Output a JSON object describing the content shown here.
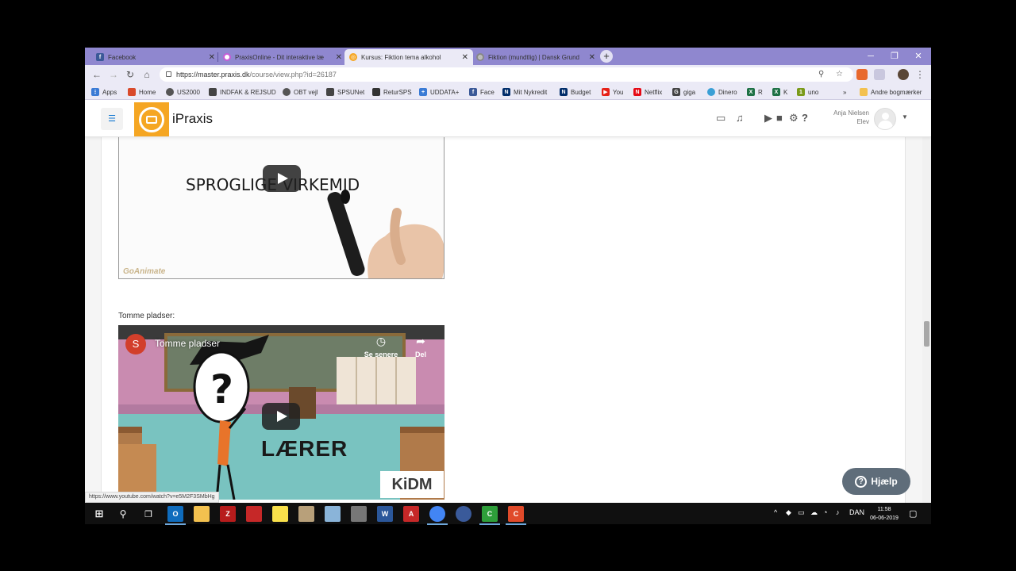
{
  "browser": {
    "tabs": [
      {
        "label": "Facebook",
        "favicon": "facebook-icon",
        "color": "#3b5998"
      },
      {
        "label": "PraxisOnline - Dit interaktive læ",
        "favicon": "praxis-online-icon",
        "color": "#c85bd6"
      },
      {
        "label": "Kursus: Fiktion tema alkohol",
        "favicon": "ipraxis-icon",
        "color": "#f5a623"
      },
      {
        "label": "Fiktion (mundtlig) | Dansk Grund",
        "favicon": "globe-icon",
        "color": "#777777"
      }
    ],
    "close_glyph": "✕",
    "window_controls": {
      "minimize": "─",
      "maximize": "❐",
      "close": "✕"
    },
    "url_host": "https://master.praxis.dk",
    "url_path": "/course/view.php?id=26187"
  },
  "bookmarks": {
    "items": [
      {
        "label": "Apps",
        "color": "#3a7bd5"
      },
      {
        "label": "Home",
        "color": "#d94a2b"
      },
      {
        "label": "US2000",
        "color": "#555555"
      },
      {
        "label": "INDFAK & REJSUD",
        "color": "#444444"
      },
      {
        "label": "OBT vejl",
        "color": "#555555"
      },
      {
        "label": "SPSUNet",
        "color": "#444444"
      },
      {
        "label": "ReturSPS",
        "color": "#333333"
      },
      {
        "label": "UDDATA+",
        "color": "#3a7bd5"
      },
      {
        "label": "Face",
        "color": "#3b5998"
      },
      {
        "label": "Mit Nykredit",
        "color": "#002d6a"
      },
      {
        "label": "Budget",
        "color": "#002d6a"
      },
      {
        "label": "You",
        "color": "#e62117"
      },
      {
        "label": "Netflix",
        "color": "#e50914"
      },
      {
        "label": "giga",
        "color": "#444444"
      },
      {
        "label": "Dinero",
        "color": "#3a9fd5"
      },
      {
        "label": "R",
        "color": "#1e7145"
      },
      {
        "label": "K",
        "color": "#1e7145"
      },
      {
        "label": "uno",
        "color": "#7a9a1a"
      }
    ],
    "overflow": "»",
    "other_label": "Andre bogmærker"
  },
  "site": {
    "brand": "iPraxis",
    "user_name": "Anja Nielsen",
    "user_role": "Elev",
    "accent": "#f5a623"
  },
  "content": {
    "video1_text": "SPROGLIGE VIRKEMID",
    "video1_watermark": "GoAnimate",
    "caption": "Tomme pladser:",
    "video2_channel_initial": "S",
    "video2_title": "Tomme pladser",
    "video2_watch_later": "Se senere",
    "video2_share": "Del",
    "video2_big_text": "LÆRER",
    "video2_logo": "KiDM",
    "status_url": "https://www.youtube.com/watch?v=e5M2F3SMbHg",
    "help_label": "Hjælp"
  },
  "taskbar": {
    "lang": "DAN",
    "time": "11:58",
    "date": "06-06-2019"
  }
}
